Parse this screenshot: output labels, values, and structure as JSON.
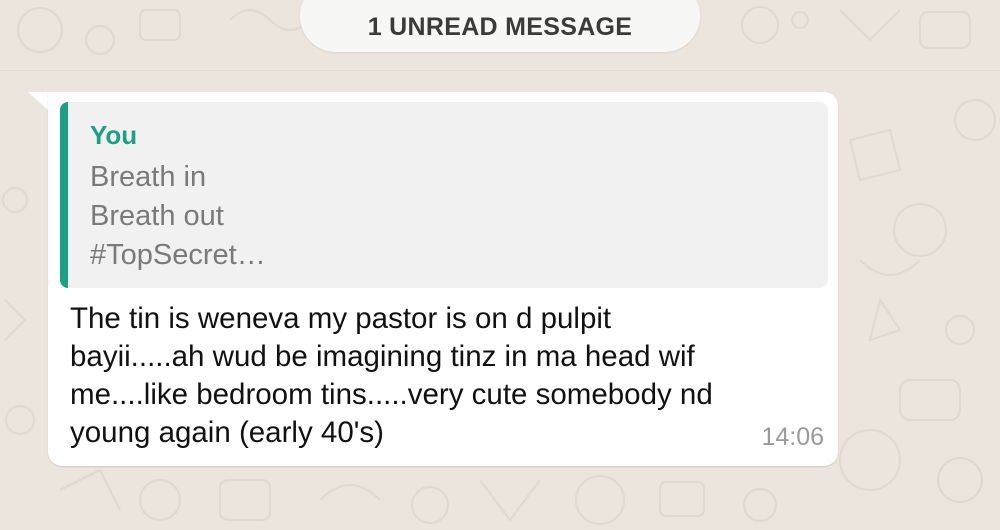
{
  "banner": {
    "unread_label": "1 UNREAD MESSAGE"
  },
  "message": {
    "quoted": {
      "author": "You",
      "lines": [
        "Breath in",
        "Breath out",
        "#TopSecret…"
      ]
    },
    "body_lines": [
      "The tin is weneva my pastor is on d pulpit",
      "bayii.....ah wud be imagining tinz in ma head wif",
      "me....like bedroom tins.....very cute somebody nd",
      "young again (early 40's)"
    ],
    "time": "14:06"
  },
  "colors": {
    "chat_background": "#ece5dd",
    "quote_accent": "#1f9e86",
    "bubble": "#ffffff"
  }
}
